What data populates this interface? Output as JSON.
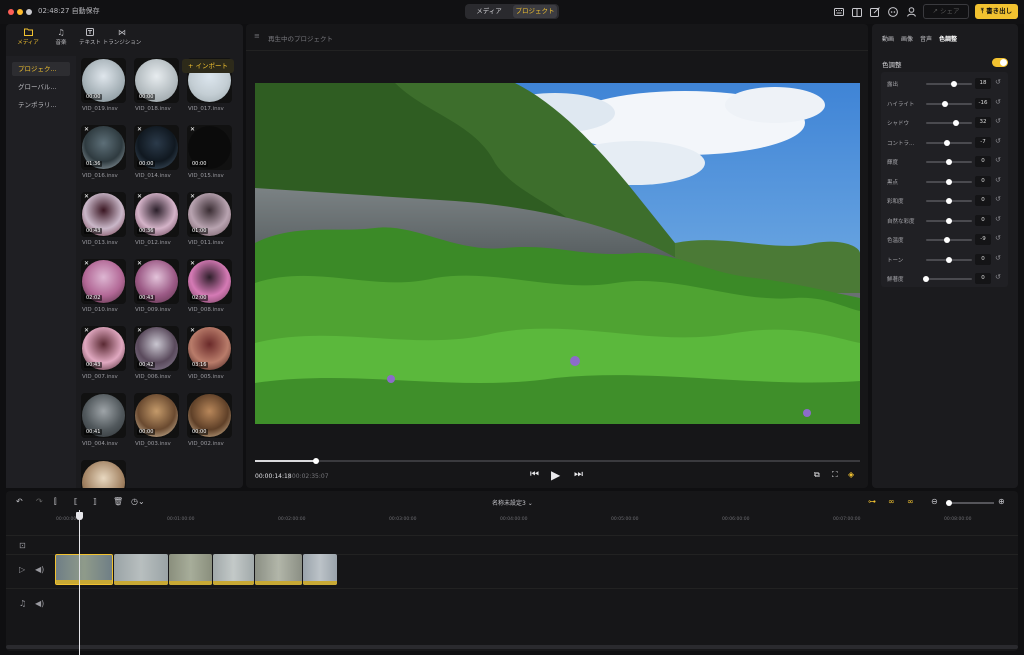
{
  "titlebar": {
    "autosave": "02:48:27 自動保存",
    "tabs": [
      "メディア",
      "プロジェクト"
    ],
    "active_tab": 1,
    "share_label": "シェア",
    "export_label": "書き出し",
    "icons": [
      "keyboard-icon",
      "layout-icon",
      "edit-icon",
      "discord-icon",
      "account-icon"
    ]
  },
  "media_panel": {
    "tabs": [
      {
        "label": "メディア",
        "icon": "folder-icon"
      },
      {
        "label": "音楽",
        "icon": "music-icon"
      },
      {
        "label": "テキスト",
        "icon": "text-icon"
      },
      {
        "label": "トランジション",
        "icon": "transition-icon"
      }
    ],
    "nav": [
      "プロジェク...",
      "グローバル...",
      "テンポラリ..."
    ],
    "import_label": "+ インポート",
    "files": [
      {
        "name": "VID_019.insv",
        "duration": "00:00"
      },
      {
        "name": "VID_018.insv",
        "duration": "00:00"
      },
      {
        "name": "VID_017.insv",
        "duration": ""
      },
      {
        "name": "VID_016.insv",
        "duration": "01:36"
      },
      {
        "name": "VID_014.insv",
        "duration": "00:00"
      },
      {
        "name": "VID_015.insv",
        "duration": "00:00"
      },
      {
        "name": "VID_013.insv",
        "duration": "00:43"
      },
      {
        "name": "VID_012.insv",
        "duration": "00:36"
      },
      {
        "name": "VID_011.insv",
        "duration": "01:00"
      },
      {
        "name": "VID_010.insv",
        "duration": "02:02"
      },
      {
        "name": "VID_009.insv",
        "duration": "00:43"
      },
      {
        "name": "VID_008.insv",
        "duration": "02:00"
      },
      {
        "name": "VID_007.insv",
        "duration": "00:43"
      },
      {
        "name": "VID_006.insv",
        "duration": "00:42"
      },
      {
        "name": "VID_005.insv",
        "duration": "03:16"
      },
      {
        "name": "VID_004.insv",
        "duration": "00:41"
      },
      {
        "name": "VID_003.insv",
        "duration": "00:00"
      },
      {
        "name": "VID_002.insv",
        "duration": "00:00"
      }
    ]
  },
  "preview": {
    "project_label": "再生中のプロジェクト",
    "current_time": "00:00:14:18",
    "total_time": "/ 00:02:35:07",
    "progress": 0.1
  },
  "adjust_panel": {
    "tabs": [
      "動画",
      "画像",
      "音声",
      "色調整"
    ],
    "active_tab": 3,
    "title": "色調整",
    "enabled": true,
    "rows": [
      {
        "label": "露出",
        "value": "18",
        "pos": 0.6
      },
      {
        "label": "ハイライト",
        "value": "-16",
        "pos": 0.42
      },
      {
        "label": "シャドウ",
        "value": "32",
        "pos": 0.66
      },
      {
        "label": "コントラ...",
        "value": "-7",
        "pos": 0.46
      },
      {
        "label": "輝度",
        "value": "0",
        "pos": 0.5
      },
      {
        "label": "黒点",
        "value": "0",
        "pos": 0.5
      },
      {
        "label": "彩和度",
        "value": "0",
        "pos": 0.5
      },
      {
        "label": "自然な彩度",
        "value": "0",
        "pos": 0.5
      },
      {
        "label": "色温度",
        "value": "-9",
        "pos": 0.46
      },
      {
        "label": "トーン",
        "value": "0",
        "pos": 0.5
      },
      {
        "label": "鮮著度",
        "value": "0",
        "pos": 0.0
      }
    ]
  },
  "timeline": {
    "sequence_name": "名称未設定3 ⌄",
    "ruler": [
      "00:00:00",
      "00:01:00:00",
      "00:02:00:00",
      "00:03:00:00",
      "00:04:00:00",
      "00:05:00:00",
      "00:06:00:00",
      "00:07:00:00",
      "00:08:00:00"
    ],
    "clip_count": 6
  }
}
